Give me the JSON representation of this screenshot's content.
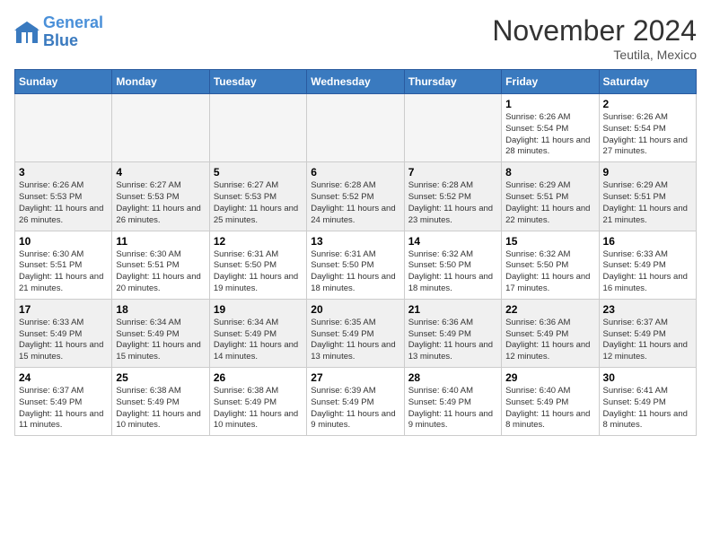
{
  "logo": {
    "line1": "General",
    "line2": "Blue"
  },
  "title": "November 2024",
  "location": "Teutila, Mexico",
  "weekdays": [
    "Sunday",
    "Monday",
    "Tuesday",
    "Wednesday",
    "Thursday",
    "Friday",
    "Saturday"
  ],
  "weeks": [
    [
      {
        "day": "",
        "info": ""
      },
      {
        "day": "",
        "info": ""
      },
      {
        "day": "",
        "info": ""
      },
      {
        "day": "",
        "info": ""
      },
      {
        "day": "",
        "info": ""
      },
      {
        "day": "1",
        "info": "Sunrise: 6:26 AM\nSunset: 5:54 PM\nDaylight: 11 hours and 28 minutes."
      },
      {
        "day": "2",
        "info": "Sunrise: 6:26 AM\nSunset: 5:54 PM\nDaylight: 11 hours and 27 minutes."
      }
    ],
    [
      {
        "day": "3",
        "info": "Sunrise: 6:26 AM\nSunset: 5:53 PM\nDaylight: 11 hours and 26 minutes."
      },
      {
        "day": "4",
        "info": "Sunrise: 6:27 AM\nSunset: 5:53 PM\nDaylight: 11 hours and 26 minutes."
      },
      {
        "day": "5",
        "info": "Sunrise: 6:27 AM\nSunset: 5:53 PM\nDaylight: 11 hours and 25 minutes."
      },
      {
        "day": "6",
        "info": "Sunrise: 6:28 AM\nSunset: 5:52 PM\nDaylight: 11 hours and 24 minutes."
      },
      {
        "day": "7",
        "info": "Sunrise: 6:28 AM\nSunset: 5:52 PM\nDaylight: 11 hours and 23 minutes."
      },
      {
        "day": "8",
        "info": "Sunrise: 6:29 AM\nSunset: 5:51 PM\nDaylight: 11 hours and 22 minutes."
      },
      {
        "day": "9",
        "info": "Sunrise: 6:29 AM\nSunset: 5:51 PM\nDaylight: 11 hours and 21 minutes."
      }
    ],
    [
      {
        "day": "10",
        "info": "Sunrise: 6:30 AM\nSunset: 5:51 PM\nDaylight: 11 hours and 21 minutes."
      },
      {
        "day": "11",
        "info": "Sunrise: 6:30 AM\nSunset: 5:51 PM\nDaylight: 11 hours and 20 minutes."
      },
      {
        "day": "12",
        "info": "Sunrise: 6:31 AM\nSunset: 5:50 PM\nDaylight: 11 hours and 19 minutes."
      },
      {
        "day": "13",
        "info": "Sunrise: 6:31 AM\nSunset: 5:50 PM\nDaylight: 11 hours and 18 minutes."
      },
      {
        "day": "14",
        "info": "Sunrise: 6:32 AM\nSunset: 5:50 PM\nDaylight: 11 hours and 18 minutes."
      },
      {
        "day": "15",
        "info": "Sunrise: 6:32 AM\nSunset: 5:50 PM\nDaylight: 11 hours and 17 minutes."
      },
      {
        "day": "16",
        "info": "Sunrise: 6:33 AM\nSunset: 5:49 PM\nDaylight: 11 hours and 16 minutes."
      }
    ],
    [
      {
        "day": "17",
        "info": "Sunrise: 6:33 AM\nSunset: 5:49 PM\nDaylight: 11 hours and 15 minutes."
      },
      {
        "day": "18",
        "info": "Sunrise: 6:34 AM\nSunset: 5:49 PM\nDaylight: 11 hours and 15 minutes."
      },
      {
        "day": "19",
        "info": "Sunrise: 6:34 AM\nSunset: 5:49 PM\nDaylight: 11 hours and 14 minutes."
      },
      {
        "day": "20",
        "info": "Sunrise: 6:35 AM\nSunset: 5:49 PM\nDaylight: 11 hours and 13 minutes."
      },
      {
        "day": "21",
        "info": "Sunrise: 6:36 AM\nSunset: 5:49 PM\nDaylight: 11 hours and 13 minutes."
      },
      {
        "day": "22",
        "info": "Sunrise: 6:36 AM\nSunset: 5:49 PM\nDaylight: 11 hours and 12 minutes."
      },
      {
        "day": "23",
        "info": "Sunrise: 6:37 AM\nSunset: 5:49 PM\nDaylight: 11 hours and 12 minutes."
      }
    ],
    [
      {
        "day": "24",
        "info": "Sunrise: 6:37 AM\nSunset: 5:49 PM\nDaylight: 11 hours and 11 minutes."
      },
      {
        "day": "25",
        "info": "Sunrise: 6:38 AM\nSunset: 5:49 PM\nDaylight: 11 hours and 10 minutes."
      },
      {
        "day": "26",
        "info": "Sunrise: 6:38 AM\nSunset: 5:49 PM\nDaylight: 11 hours and 10 minutes."
      },
      {
        "day": "27",
        "info": "Sunrise: 6:39 AM\nSunset: 5:49 PM\nDaylight: 11 hours and 9 minutes."
      },
      {
        "day": "28",
        "info": "Sunrise: 6:40 AM\nSunset: 5:49 PM\nDaylight: 11 hours and 9 minutes."
      },
      {
        "day": "29",
        "info": "Sunrise: 6:40 AM\nSunset: 5:49 PM\nDaylight: 11 hours and 8 minutes."
      },
      {
        "day": "30",
        "info": "Sunrise: 6:41 AM\nSunset: 5:49 PM\nDaylight: 11 hours and 8 minutes."
      }
    ]
  ]
}
